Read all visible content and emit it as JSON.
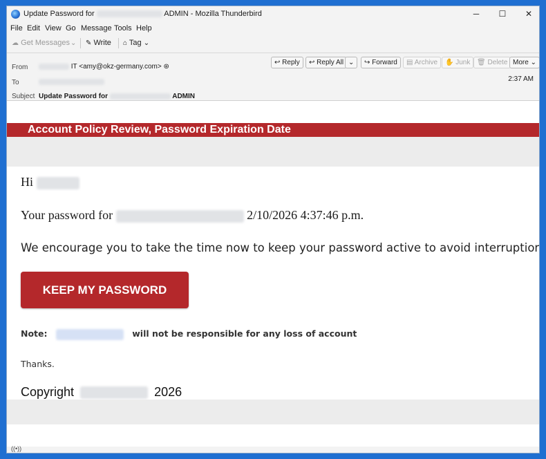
{
  "window": {
    "title_prefix": "Update Password for",
    "title_suffix": "ADMIN - Mozilla Thunderbird",
    "minimize": "─",
    "maximize": "☐",
    "close": "✕"
  },
  "menu": {
    "file": "File",
    "edit": "Edit",
    "view": "View",
    "go": "Go",
    "message": "Message",
    "tools": "Tools",
    "help": "Help"
  },
  "toolbar": {
    "get_messages": "Get Messages",
    "write": "Write",
    "tag": "Tag"
  },
  "header": {
    "from_label": "From",
    "from_value": "IT <amy@okz-germany.com>",
    "to_label": "To",
    "subject_label": "Subject",
    "subject_prefix": "Update Password for",
    "subject_suffix": "ADMIN",
    "time": "2:37 AM",
    "buttons": {
      "reply": "Reply",
      "reply_all": "Reply All",
      "forward": "Forward",
      "archive": "Archive",
      "junk": "Junk",
      "delete": "Delete",
      "more": "More"
    }
  },
  "email": {
    "banner": "Account Policy Review, Password Expiration Date",
    "greeting": "Hi",
    "password_prefix": "Your password for",
    "password_date": "2/10/2026 4:37:46 p.m.",
    "encourage": "We encourage you to take the time now to keep your password active to avoid interruptions.",
    "button": "KEEP MY PASSWORD",
    "note_label": "Note:",
    "note_text": "will not be responsible for any loss of account",
    "thanks": "Thanks.",
    "copyright_prefix": "Copyright",
    "copyright_year": "2026"
  },
  "colors": {
    "brand_red": "#b4282b",
    "desktop_blue": "#1f6fd1"
  }
}
